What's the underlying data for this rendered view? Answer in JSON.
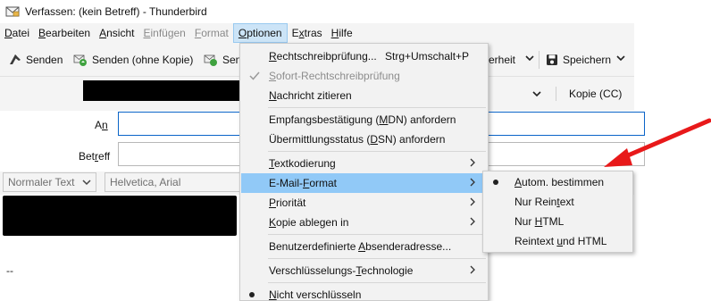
{
  "window": {
    "title": "Verfassen: (kein Betreff) - Thunderbird",
    "icon": "compose-envelope-icon"
  },
  "menubar": [
    {
      "label": "Datei",
      "mnemonic": "D",
      "rest": "atei",
      "state": "normal"
    },
    {
      "label": "Bearbeiten",
      "mnemonic": "B",
      "rest": "earbeiten",
      "state": "normal"
    },
    {
      "label": "Ansicht",
      "mnemonic": "A",
      "rest": "nsicht",
      "state": "normal"
    },
    {
      "label": "Einfügen",
      "mnemonic": "E",
      "rest": "infügen",
      "state": "disabled"
    },
    {
      "label": "Format",
      "mnemonic": "F",
      "rest": "ormat",
      "state": "disabled"
    },
    {
      "label": "Optionen",
      "mnemonic": "O",
      "rest": "ptionen",
      "state": "active"
    },
    {
      "label": "Extras",
      "pre": "E",
      "mnemonic": "x",
      "rest": "tras",
      "state": "normal"
    },
    {
      "label": "Hilfe",
      "mnemonic": "H",
      "rest": "ilfe",
      "state": "normal"
    }
  ],
  "toolbar": {
    "send": "Senden",
    "send_no_copy": "Senden (ohne Kopie)",
    "send_partial": "Sen",
    "security_partial": "erheit",
    "save": "Speichern"
  },
  "header": {
    "cc_label": "Kopie (CC)",
    "to_label_pre": "A",
    "to_label_u": "n",
    "subject_label_pre": "Bet",
    "subject_label_u": "r",
    "subject_label_post": "eff",
    "to_value": "",
    "subject_value": ""
  },
  "formatbar": {
    "paragraph_format": "Normaler Text",
    "font": "Helvetica, Arial"
  },
  "body": {
    "signature_separator": "--"
  },
  "options_menu": {
    "items": [
      {
        "type": "item",
        "pre": "",
        "u": "R",
        "post": "echtschreibprüfung...",
        "accel": "Strg+Umschalt+P",
        "state": "normal"
      },
      {
        "type": "item",
        "pre": "",
        "u": "S",
        "post": "ofort-Rechtschreibprüfung",
        "state": "disabled",
        "checked": true
      },
      {
        "type": "item",
        "pre": "",
        "u": "N",
        "post": "achricht zitieren",
        "state": "normal"
      },
      {
        "type": "separator"
      },
      {
        "type": "item",
        "pre": "Empfangsbestätigung (",
        "u": "M",
        "post": "DN) anfordern",
        "state": "normal"
      },
      {
        "type": "item",
        "pre": "Übermittlungsstatus (",
        "u": "D",
        "post": "SN) anfordern",
        "state": "normal"
      },
      {
        "type": "separator"
      },
      {
        "type": "item",
        "pre": "",
        "u": "T",
        "post": "extkodierung",
        "submenu": true,
        "state": "normal"
      },
      {
        "type": "item",
        "pre": "E-Mail-",
        "u": "F",
        "post": "ormat",
        "submenu": true,
        "state": "highlight"
      },
      {
        "type": "item",
        "pre": "",
        "u": "P",
        "post": "riorität",
        "submenu": true,
        "state": "normal"
      },
      {
        "type": "item",
        "pre": "",
        "u": "K",
        "post": "opie ablegen in",
        "submenu": true,
        "state": "normal"
      },
      {
        "type": "separator"
      },
      {
        "type": "item",
        "pre": "Benutzerdefinierte ",
        "u": "A",
        "post": "bsenderadresse...",
        "state": "normal"
      },
      {
        "type": "separator"
      },
      {
        "type": "item",
        "pre": "Verschlüsselungs-",
        "u": "T",
        "post": "echnologie",
        "submenu": true,
        "state": "normal"
      },
      {
        "type": "separator"
      },
      {
        "type": "item",
        "pre": "",
        "u": "N",
        "post": "icht verschlüsseln",
        "state": "normal",
        "radio": true
      }
    ]
  },
  "email_format_submenu": {
    "items": [
      {
        "pre": "",
        "u": "A",
        "post": "utom. bestimmen",
        "selected": true
      },
      {
        "pre": "Nur Rein",
        "u": "t",
        "post": "ext",
        "selected": false
      },
      {
        "pre": "Nur ",
        "u": "H",
        "post": "TML",
        "selected": false
      },
      {
        "pre": "Reintext ",
        "u": "u",
        "post": "nd HTML",
        "selected": false
      }
    ]
  },
  "annotation": {
    "color": "#e8191a",
    "icon": "red-arrow-pointer"
  }
}
